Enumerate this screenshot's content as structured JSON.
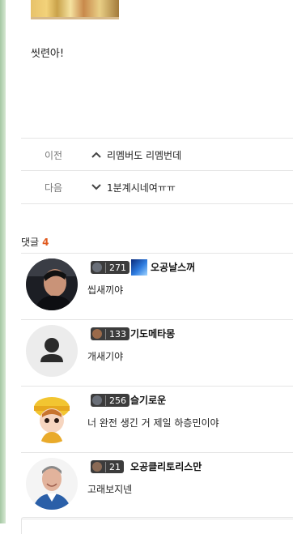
{
  "post": {
    "body_text": "씻련아!"
  },
  "nav": {
    "prev": {
      "label": "이전",
      "title": "리멤버도 리멤번데"
    },
    "next": {
      "label": "다음",
      "title": "1분계시네여ㅠㅠ"
    }
  },
  "comments_header": {
    "label": "댓글",
    "count": "4"
  },
  "comments": [
    {
      "level": "271",
      "nickname": "오공날스꺼",
      "text": "씹새끼야"
    },
    {
      "level": "133",
      "nickname": "기도메타몽",
      "text": "개새기야"
    },
    {
      "level": "256",
      "nickname": "슬기로운",
      "text": "너 완전 생긴 거 제일 하층민이야"
    },
    {
      "level": "21",
      "nickname": "오공클리토리스만",
      "text": "고래보지넨"
    }
  ],
  "colors": {
    "accent": "#e05a1f",
    "badge_bg": "#3c3c3c",
    "divider": "#e5e5e5"
  },
  "icons": {
    "prev": "chevron-up-icon",
    "next": "chevron-down-icon",
    "default_avatar": "user-silhouette-icon"
  }
}
